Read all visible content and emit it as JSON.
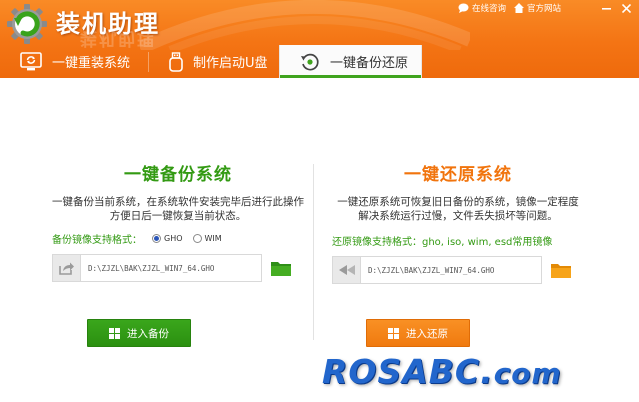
{
  "app": {
    "title": "装机助理",
    "title_reflection": "装机助理"
  },
  "top_links": [
    {
      "label": "在线咨询",
      "icon": "chat-bubble-icon"
    },
    {
      "label": "官方网站",
      "icon": "home-icon"
    }
  ],
  "window_controls": [
    "minimize-icon",
    "close-icon"
  ],
  "tabs": [
    {
      "label": "一键重装系统",
      "icon": "monitor-refresh-icon",
      "active": false
    },
    {
      "label": "制作启动U盘",
      "icon": "usb-drive-icon",
      "active": false
    },
    {
      "label": "一键备份还原",
      "icon": "backup-restore-icon",
      "active": true
    }
  ],
  "backup": {
    "title": "一键备份系统",
    "desc_line1": "一键备份当前系统，在系统软件安装完毕后进行此操作",
    "desc_line2": "方便日后一键恢复当前状态。",
    "format_label": "备份镜像支持格式：",
    "formats": [
      {
        "label": "GHO",
        "selected": true
      },
      {
        "label": "WIM",
        "selected": false
      }
    ],
    "path": "D:\\ZJZL\\BAK\\ZJZL_WIN7_64.GHO",
    "button_label": "进入备份"
  },
  "restore": {
    "title": "一键还原系统",
    "desc_line1": "一键还原系统可恢复旧日备份的系统，镜像一定程度",
    "desc_line2": "解决系统运行过慢，文件丢失损坏等问题。",
    "format_label": "还原镜像支持格式：gho, iso, wim, esd常用镜像",
    "path": "D:\\ZJZL\\BAK\\ZJZL_WIN7_64.GHO",
    "button_label": "进入还原"
  },
  "watermark": {
    "main": "ROSABC.",
    "suffix": "com"
  },
  "colors": {
    "header_orange": "#f47414",
    "accent_green": "#339a13",
    "accent_orange": "#f1740d",
    "watermark_blue": "#2266cc"
  }
}
